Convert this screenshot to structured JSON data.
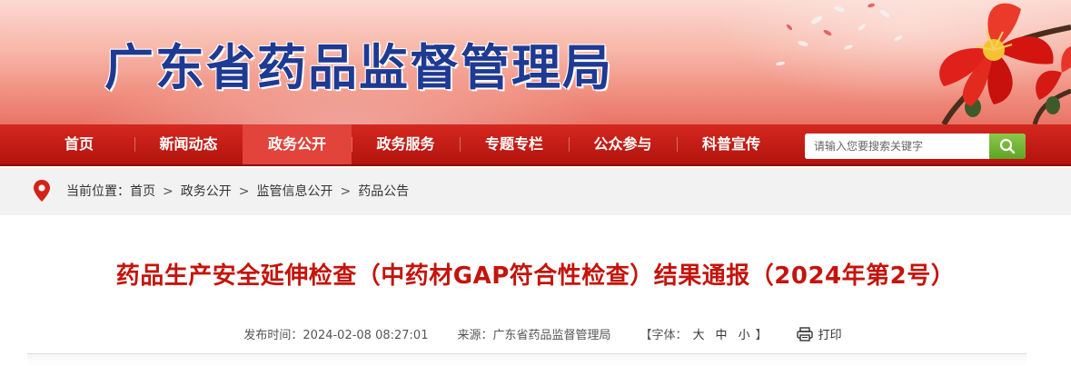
{
  "header": {
    "site_title": "广东省药品监督管理局"
  },
  "nav": {
    "items": [
      {
        "label": "首页"
      },
      {
        "label": "新闻动态"
      },
      {
        "label": "政务公开"
      },
      {
        "label": "政务服务"
      },
      {
        "label": "专题专栏"
      },
      {
        "label": "公众参与"
      },
      {
        "label": "科普宣传"
      }
    ],
    "active_index": 2
  },
  "search": {
    "placeholder": "请输入您要搜索关键字",
    "icon": "search-icon"
  },
  "breadcrumb": {
    "prefix": "当前位置：",
    "items": [
      "首页",
      "政务公开",
      "监管信息公开",
      "药品公告"
    ],
    "separator": ">",
    "icon": "location-pin-icon"
  },
  "article": {
    "title": "药品生产安全延伸检查（中药材GAP符合性检查）结果通报（2024年第2号）",
    "publish_label": "发布时间：",
    "publish_time": "2024-02-08 08:27:01",
    "source_label": "来源：",
    "source": "广东省药品监督管理局",
    "font_label_open": "【字体：",
    "font_large": "大",
    "font_medium": "中",
    "font_small": "小",
    "font_label_close": "】",
    "print_label": "打印",
    "print_icon": "printer-icon"
  },
  "colors": {
    "nav_red": "#b3130e",
    "nav_active": "#e2433a",
    "title_red": "#c4140c",
    "site_title_blue": "#1f3a93",
    "search_green": "#6cb22f"
  }
}
